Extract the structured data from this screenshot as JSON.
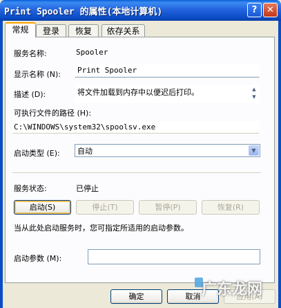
{
  "window": {
    "title": "Print Spooler 的属性(本地计算机)",
    "help_glyph": "?",
    "close_glyph": "✕"
  },
  "tabs": [
    {
      "label": "常规",
      "active": true
    },
    {
      "label": "登录"
    },
    {
      "label": "恢复"
    },
    {
      "label": "依存关系"
    }
  ],
  "general": {
    "service_name_label": "服务名称:",
    "service_name_value": "Spooler",
    "display_name_label": "显示名称 (N):",
    "display_name_value": "Print Spooler",
    "description_label": "描述 (D):",
    "description_value": "将文件加载到内存中以便迟后打印。",
    "exe_path_label": "可执行文件的路径 (H):",
    "exe_path_value": "C:\\WINDOWS\\system32\\spoolsv.exe",
    "startup_type_label": "启动类型 (E):",
    "startup_type_value": "自动",
    "service_status_label": "服务状态:",
    "service_status_value": "已停止",
    "hint_text": "当从此处启动服务时，您可指定所适用的启动参数。",
    "start_params_label": "启动参数 (M):",
    "start_params_value": ""
  },
  "service_buttons": {
    "start": "启动(S)",
    "stop": "停止(T)",
    "pause": "暂停(P)",
    "resume": "恢复(R)"
  },
  "dialog_buttons": {
    "ok": "确定",
    "cancel": "取消",
    "apply": "应用(A)"
  },
  "watermark": "广东龙网"
}
